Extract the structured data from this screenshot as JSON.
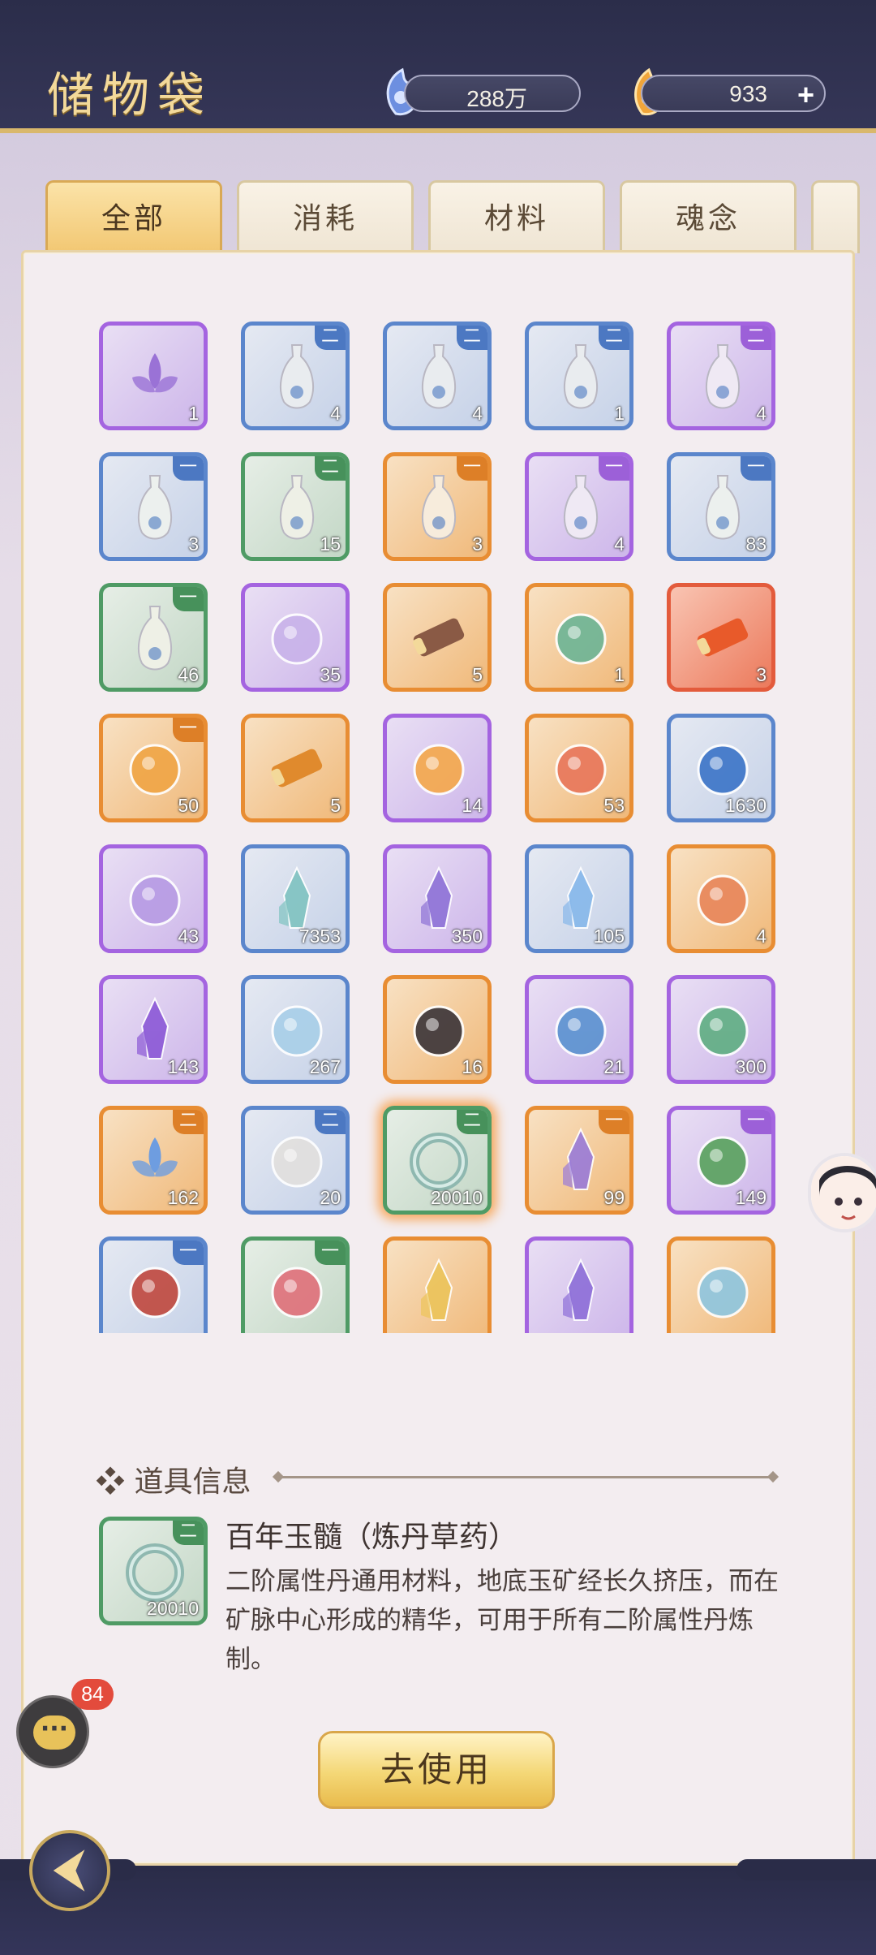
{
  "header": {
    "title": "储物袋",
    "resource1": "288万",
    "resource2": "933",
    "plus_label": "+"
  },
  "tabs": [
    {
      "label": "全部",
      "active": true
    },
    {
      "label": "消耗",
      "active": false
    },
    {
      "label": "材料",
      "active": false
    },
    {
      "label": "魂念",
      "active": false
    }
  ],
  "items": [
    {
      "count": "1",
      "rarity": "purple",
      "tier": "",
      "icon": "lotus-icon",
      "color": "#9a72d6"
    },
    {
      "count": "4",
      "rarity": "blue",
      "tier": "二",
      "icon": "vase-icon",
      "color": "#e9ecef"
    },
    {
      "count": "4",
      "rarity": "blue",
      "tier": "二",
      "icon": "vase-icon",
      "color": "#e9ecef"
    },
    {
      "count": "1",
      "rarity": "blue",
      "tier": "二",
      "icon": "vase-icon",
      "color": "#e9ecef"
    },
    {
      "count": "4",
      "rarity": "purple",
      "tier": "二",
      "icon": "vase-icon",
      "color": "#efe9f4"
    },
    {
      "count": "3",
      "rarity": "blue",
      "tier": "一",
      "icon": "vase-icon",
      "color": "#ecf0ee"
    },
    {
      "count": "15",
      "rarity": "green",
      "tier": "二",
      "icon": "vase-icon",
      "color": "#eef0e6"
    },
    {
      "count": "3",
      "rarity": "orange",
      "tier": "一",
      "icon": "vase-icon",
      "color": "#f7ecdc"
    },
    {
      "count": "4",
      "rarity": "purple",
      "tier": "一",
      "icon": "vase-icon",
      "color": "#efe9f4"
    },
    {
      "count": "83",
      "rarity": "blue",
      "tier": "一",
      "icon": "vase-icon",
      "color": "#ecf0ee"
    },
    {
      "count": "46",
      "rarity": "green",
      "tier": "一",
      "icon": "vase-icon",
      "color": "#eef0e6"
    },
    {
      "count": "35",
      "rarity": "purple",
      "tier": "",
      "icon": "gourd-icon",
      "color": "#c9b3ea"
    },
    {
      "count": "5",
      "rarity": "orange",
      "tier": "",
      "icon": "scroll-icon",
      "color": "#8a5a45"
    },
    {
      "count": "1",
      "rarity": "orange",
      "tier": "",
      "icon": "talisman-icon",
      "color": "#6cb596"
    },
    {
      "count": "3",
      "rarity": "red",
      "tier": "",
      "icon": "scroll-icon",
      "color": "#e85a2a"
    },
    {
      "count": "50",
      "rarity": "orange",
      "tier": "一",
      "icon": "beast-core-icon",
      "color": "#f0a545"
    },
    {
      "count": "5",
      "rarity": "orange",
      "tier": "",
      "icon": "scroll-icon",
      "color": "#e08a2d"
    },
    {
      "count": "14",
      "rarity": "purple",
      "tier": "",
      "icon": "orb-icon",
      "color": "#f5a84a"
    },
    {
      "count": "53",
      "rarity": "orange",
      "tier": "",
      "icon": "beast-icon",
      "color": "#e8765a"
    },
    {
      "count": "1630",
      "rarity": "blue",
      "tier": "",
      "icon": "water-orb-icon",
      "color": "#3b74c8"
    },
    {
      "count": "43",
      "rarity": "purple",
      "tier": "",
      "icon": "flower-icon",
      "color": "#b79be4"
    },
    {
      "count": "7353",
      "rarity": "blue",
      "tier": "",
      "icon": "crystal-icon",
      "color": "#7fc3c0"
    },
    {
      "count": "350",
      "rarity": "purple",
      "tier": "",
      "icon": "crystal-icon",
      "color": "#8d72d6"
    },
    {
      "count": "105",
      "rarity": "blue",
      "tier": "",
      "icon": "crystal-icon",
      "color": "#86b7ea"
    },
    {
      "count": "4",
      "rarity": "orange",
      "tier": "",
      "icon": "gem-icon",
      "color": "#e8865a"
    },
    {
      "count": "143",
      "rarity": "purple",
      "tier": "",
      "icon": "crystal-icon",
      "color": "#8b58d6"
    },
    {
      "count": "267",
      "rarity": "blue",
      "tier": "",
      "icon": "egg-icon",
      "color": "#a8cfe8"
    },
    {
      "count": "16",
      "rarity": "orange",
      "tier": "",
      "icon": "orb-icon",
      "color": "#3a3438"
    },
    {
      "count": "21",
      "rarity": "purple",
      "tier": "",
      "icon": "swirl-icon",
      "color": "#5a92d0"
    },
    {
      "count": "300",
      "rarity": "purple",
      "tier": "",
      "icon": "grass-icon",
      "color": "#5fae82"
    },
    {
      "count": "162",
      "rarity": "orange",
      "tier": "二",
      "icon": "lotus-icon",
      "color": "#6e9de0"
    },
    {
      "count": "20",
      "rarity": "blue",
      "tier": "二",
      "icon": "stone-icon",
      "color": "#e2e0de"
    },
    {
      "count": "20010",
      "rarity": "green",
      "tier": "二",
      "icon": "jade-ring-icon",
      "color": "#8fb8b0",
      "selected": true
    },
    {
      "count": "99",
      "rarity": "orange",
      "tier": "一",
      "icon": "crystal-icon",
      "color": "#9a7bd8"
    },
    {
      "count": "149",
      "rarity": "purple",
      "tier": "一",
      "icon": "berry-icon",
      "color": "#59a25d"
    },
    {
      "count": "",
      "rarity": "blue",
      "tier": "一",
      "icon": "tree-icon",
      "color": "#c0483e"
    },
    {
      "count": "",
      "rarity": "green",
      "tier": "一",
      "icon": "coral-icon",
      "color": "#e0707a"
    },
    {
      "count": "",
      "rarity": "orange",
      "tier": "",
      "icon": "crystal-icon",
      "color": "#ecc45a"
    },
    {
      "count": "",
      "rarity": "purple",
      "tier": "",
      "icon": "crystal-icon",
      "color": "#8d6ed8"
    },
    {
      "count": "",
      "rarity": "orange",
      "tier": "",
      "icon": "ice-icon",
      "color": "#8ec6e0"
    }
  ],
  "info": {
    "heading": "道具信息",
    "bullet": "❖",
    "name": "百年玉髓（炼丹草药）",
    "description": "二阶属性丹通用材料，地底玉矿经长久挤压，而在矿脉中心形成的精华，可用于所有二阶属性丹炼制。",
    "selected_count": "20010",
    "selected_tier": "二"
  },
  "use_button": "去使用",
  "chat_badge": "84"
}
